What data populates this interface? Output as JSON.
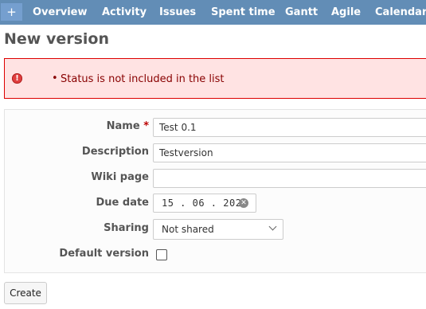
{
  "menu": {
    "add_label": "+",
    "items": [
      "Overview",
      "Activity",
      "Issues",
      "Spent time",
      "Gantt",
      "Agile",
      "Calendar"
    ]
  },
  "page_title": "New version",
  "error": {
    "icon": "exclamation-circle-icon",
    "message": "Status is not included in the list"
  },
  "form": {
    "name_label": "Name",
    "required_mark": "*",
    "name_value": "Test 0.1",
    "description_label": "Description",
    "description_value": "Testversion",
    "wiki_label": "Wiki page",
    "wiki_value": "",
    "due_date_label": "Due date",
    "due_date_value": "15 . 06 . 2023",
    "sharing_label": "Sharing",
    "sharing_value": "Not shared",
    "default_version_label": "Default version",
    "default_version_checked": false
  },
  "create_label": "Create",
  "colors": {
    "menu_bg": "#628db6",
    "error_bg": "#ffe3e3",
    "error_border": "#dd0000",
    "error_text": "#880000",
    "required": "#bb0000"
  }
}
